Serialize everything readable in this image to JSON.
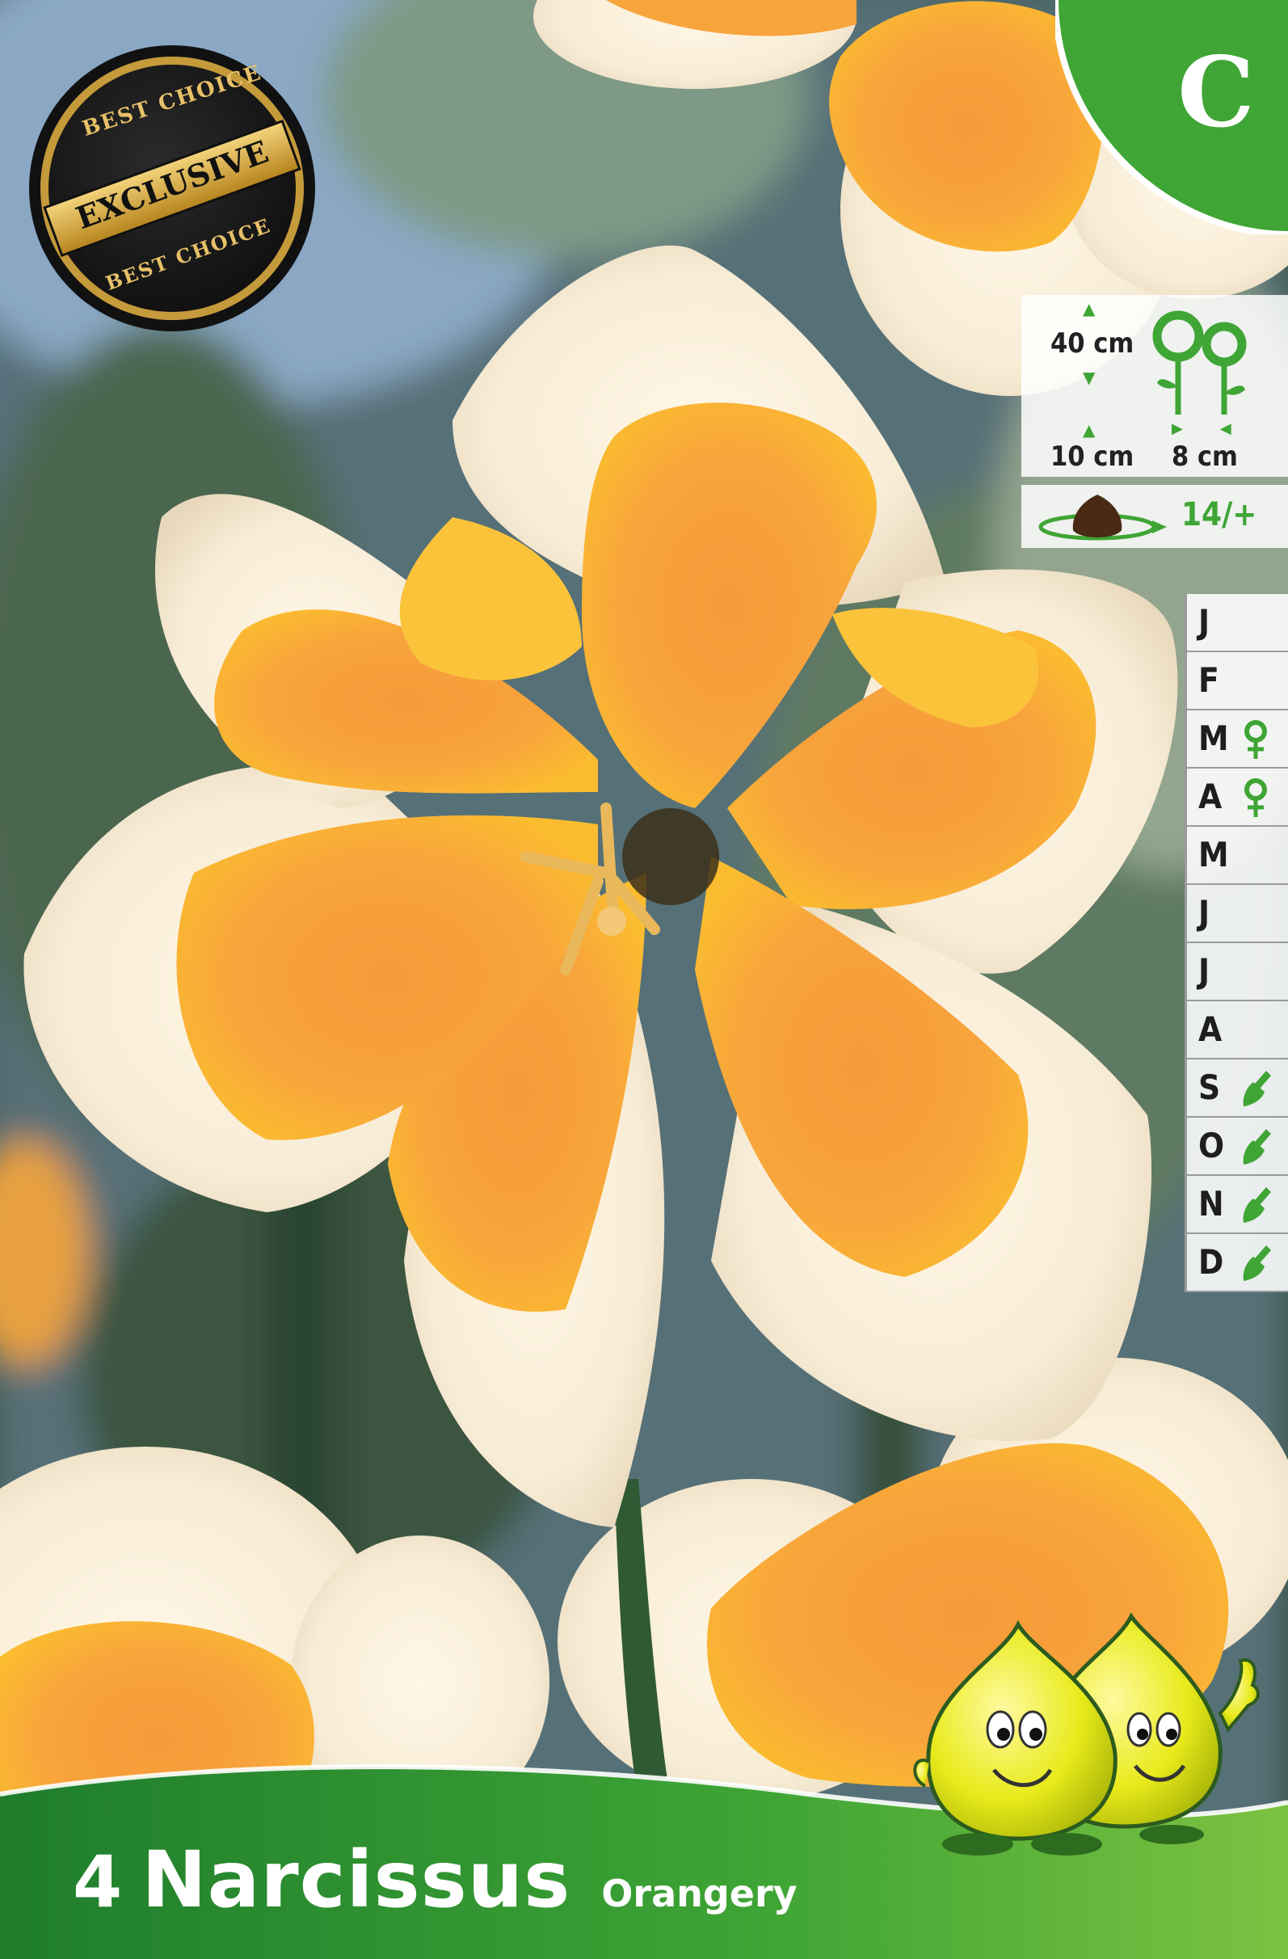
{
  "product": {
    "count": "4",
    "name": "Narcissus",
    "variety": "Orangery"
  },
  "zone_badge": {
    "letter": "C"
  },
  "seal": {
    "top_text": "BEST CHOICE",
    "center_text": "EXCLUSIVE",
    "bottom_text": "BEST CHOICE"
  },
  "specs": {
    "height": "40 cm",
    "depth": "10 cm",
    "spacing": "8 cm",
    "bulb_size": "14/+"
  },
  "months": [
    {
      "letter": "J",
      "icon": ""
    },
    {
      "letter": "F",
      "icon": ""
    },
    {
      "letter": "M",
      "icon": "flower-icon"
    },
    {
      "letter": "A",
      "icon": "flower-icon"
    },
    {
      "letter": "M",
      "icon": ""
    },
    {
      "letter": "J",
      "icon": ""
    },
    {
      "letter": "J",
      "icon": ""
    },
    {
      "letter": "A",
      "icon": ""
    },
    {
      "letter": "S",
      "icon": "trowel-icon"
    },
    {
      "letter": "O",
      "icon": "trowel-icon"
    },
    {
      "letter": "N",
      "icon": "trowel-icon"
    },
    {
      "letter": "D",
      "icon": "trowel-icon"
    }
  ],
  "colors": {
    "brand_green": "#3fa535",
    "petal_white": "#fbf3e4",
    "corona_orange": "#f7a13a"
  }
}
